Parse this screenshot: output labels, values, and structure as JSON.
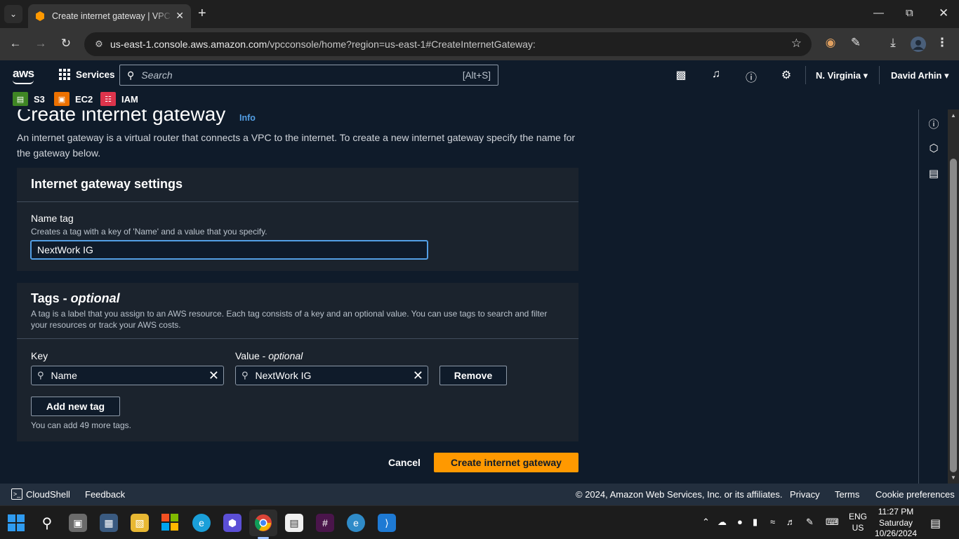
{
  "browser": {
    "tab_title": "Create internet gateway | VPC M",
    "url_host": "us-east-1.console.aws.amazon.com",
    "url_path": "/vpcconsole/home?region=us-east-1#CreateInternetGateway:"
  },
  "aws_header": {
    "logo": "aws",
    "services_label": "Services",
    "search_placeholder": "Search",
    "search_shortcut": "[Alt+S]",
    "region": "N. Virginia",
    "user": "David Arhin"
  },
  "favorites": [
    {
      "label": "S3",
      "color": "#3f8624"
    },
    {
      "label": "EC2",
      "color": "#ed7100"
    },
    {
      "label": "IAM",
      "color": "#dd344c"
    }
  ],
  "page": {
    "title": "Create internet gateway",
    "info_link": "Info",
    "description": "An internet gateway is a virtual router that connects a VPC to the internet. To create a new internet gateway specify the name for the gateway below."
  },
  "settings_panel": {
    "title": "Internet gateway settings",
    "name_tag_label": "Name tag",
    "name_tag_hint": "Creates a tag with a key of 'Name' and a value that you specify.",
    "name_tag_value": "NextWork IG"
  },
  "tags_panel": {
    "title": "Tags - ",
    "title_italic": "optional",
    "description": "A tag is a label that you assign to an AWS resource. Each tag consists of a key and an optional value. You can use tags to search and filter your resources or track your AWS costs.",
    "key_label": "Key",
    "value_label": "Value - ",
    "value_label_italic": "optional",
    "key_value": "Name",
    "value_value": "NextWork IG",
    "remove_label": "Remove",
    "add_label": "Add new tag",
    "remaining_hint": "You can add 49 more tags."
  },
  "actions": {
    "cancel_label": "Cancel",
    "create_label": "Create internet gateway",
    "create_color": "#ff9900"
  },
  "footer": {
    "cloudshell": "CloudShell",
    "feedback": "Feedback",
    "copyright": "© 2024, Amazon Web Services, Inc. or its affiliates.",
    "privacy": "Privacy",
    "terms": "Terms",
    "cookies": "Cookie preferences"
  },
  "taskbar": {
    "lang_1": "ENG",
    "lang_2": "US",
    "time": "11:27 PM",
    "day": "Saturday",
    "date": "10/26/2024"
  }
}
